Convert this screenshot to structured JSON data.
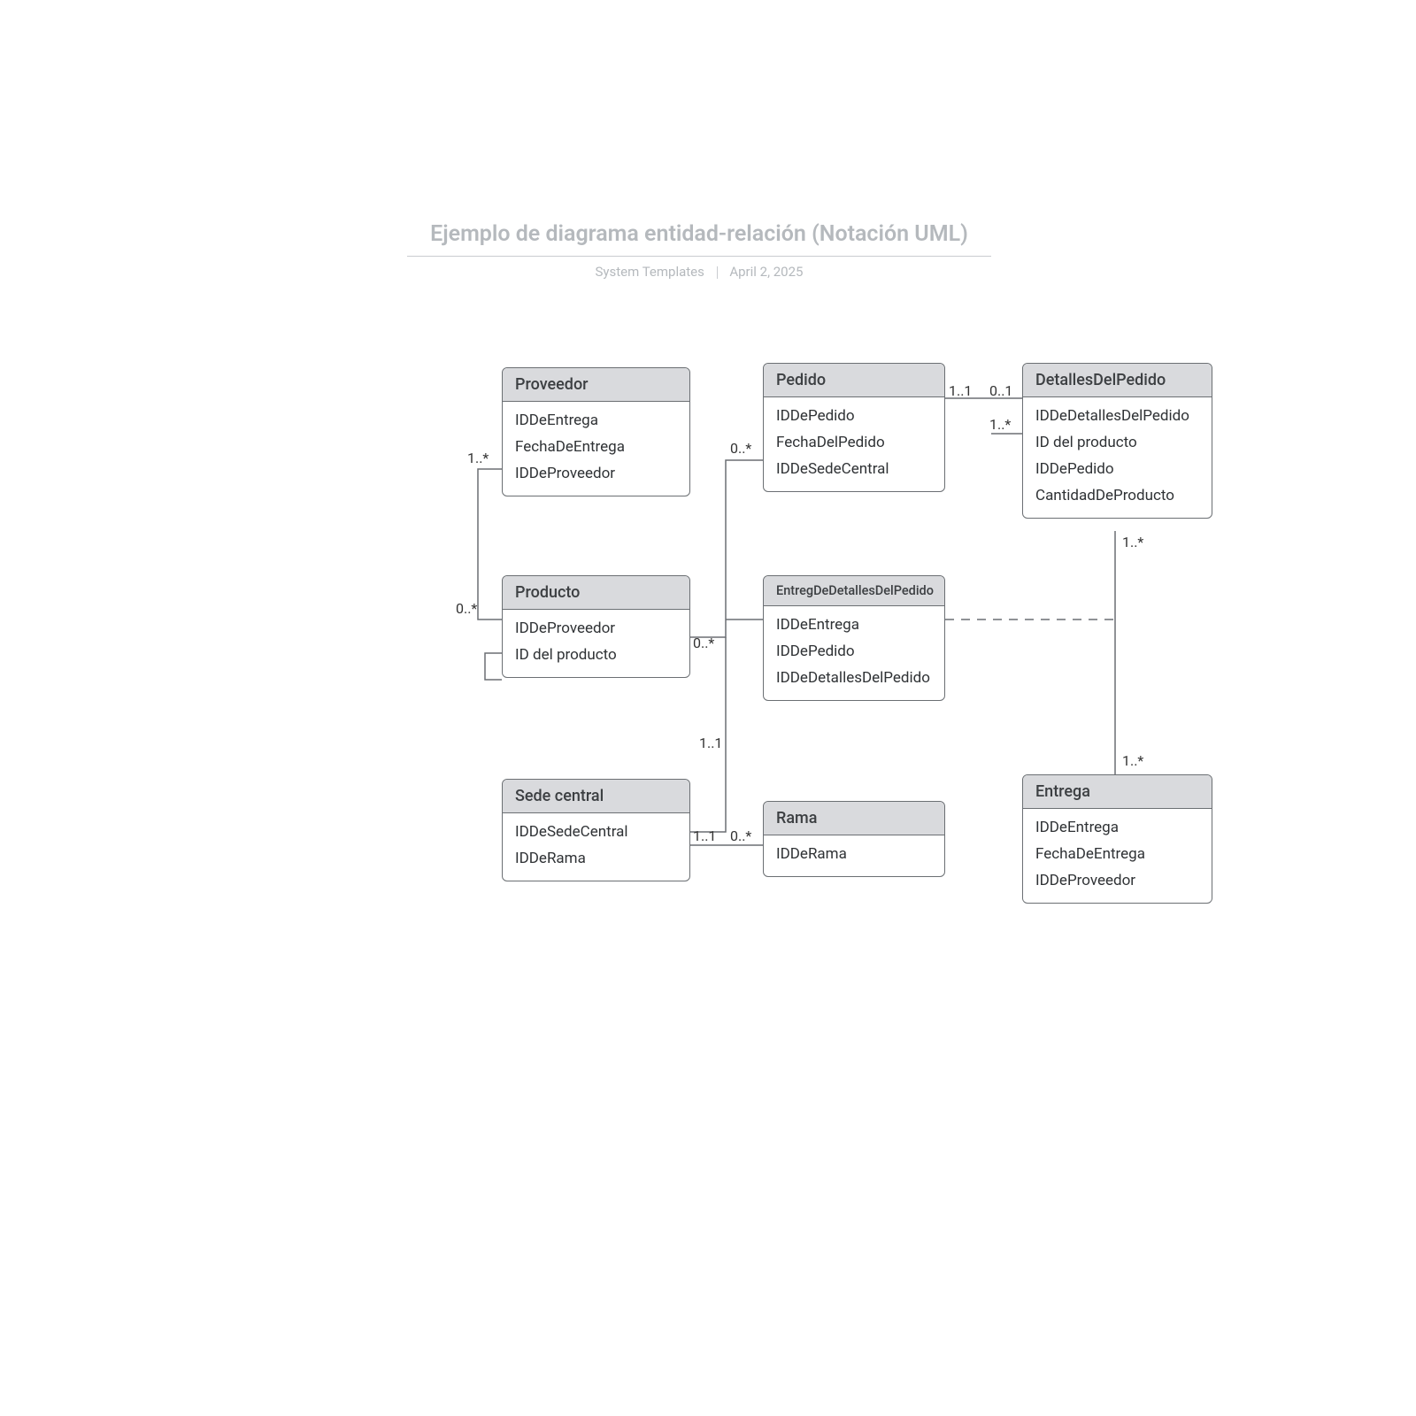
{
  "title": "Ejemplo de diagrama entidad-relación (Notación UML)",
  "subtitle_left": "System Templates",
  "subtitle_right": "April 2, 2025",
  "entities": {
    "proveedor": {
      "name": "Proveedor",
      "attrs": [
        "IDDeEntrega",
        "FechaDeEntrega",
        "IDDeProveedor"
      ]
    },
    "pedido": {
      "name": "Pedido",
      "attrs": [
        "IDDePedido",
        "FechaDelPedido",
        "IDDeSedeCentral"
      ]
    },
    "detalles": {
      "name": "DetallesDelPedido",
      "attrs": [
        "IDDeDetallesDelPedido",
        "ID del producto",
        "IDDePedido",
        "CantidadDeProducto"
      ]
    },
    "producto": {
      "name": "Producto",
      "attrs": [
        "IDDeProveedor",
        "ID del producto"
      ]
    },
    "entregaDet": {
      "name": "EntregDeDetallesDelPedido",
      "attrs": [
        "IDDeEntrega",
        "IDDePedido",
        "IDDeDetallesDelPedido"
      ]
    },
    "sede": {
      "name": "Sede central",
      "attrs": [
        "IDDeSedeCentral",
        "IDDeRama"
      ]
    },
    "rama": {
      "name": "Rama",
      "attrs": [
        "IDDeRama"
      ]
    },
    "entrega": {
      "name": "Entrega",
      "attrs": [
        "IDDeEntrega",
        "FechaDeEntrega",
        "IDDeProveedor"
      ]
    }
  },
  "mult": {
    "prov_left": "1..*",
    "prod_left": "0..*",
    "prod_right": "0..*",
    "pedido_left": "0..*",
    "pedido_right": "1..1",
    "detalles_left": "0..1",
    "detalles_below": "1..*",
    "sede_top": "1..1",
    "sede_right": "1..1",
    "rama_left": "0..*",
    "det_right_upper": "1..*",
    "entrega_top": "1..*"
  }
}
